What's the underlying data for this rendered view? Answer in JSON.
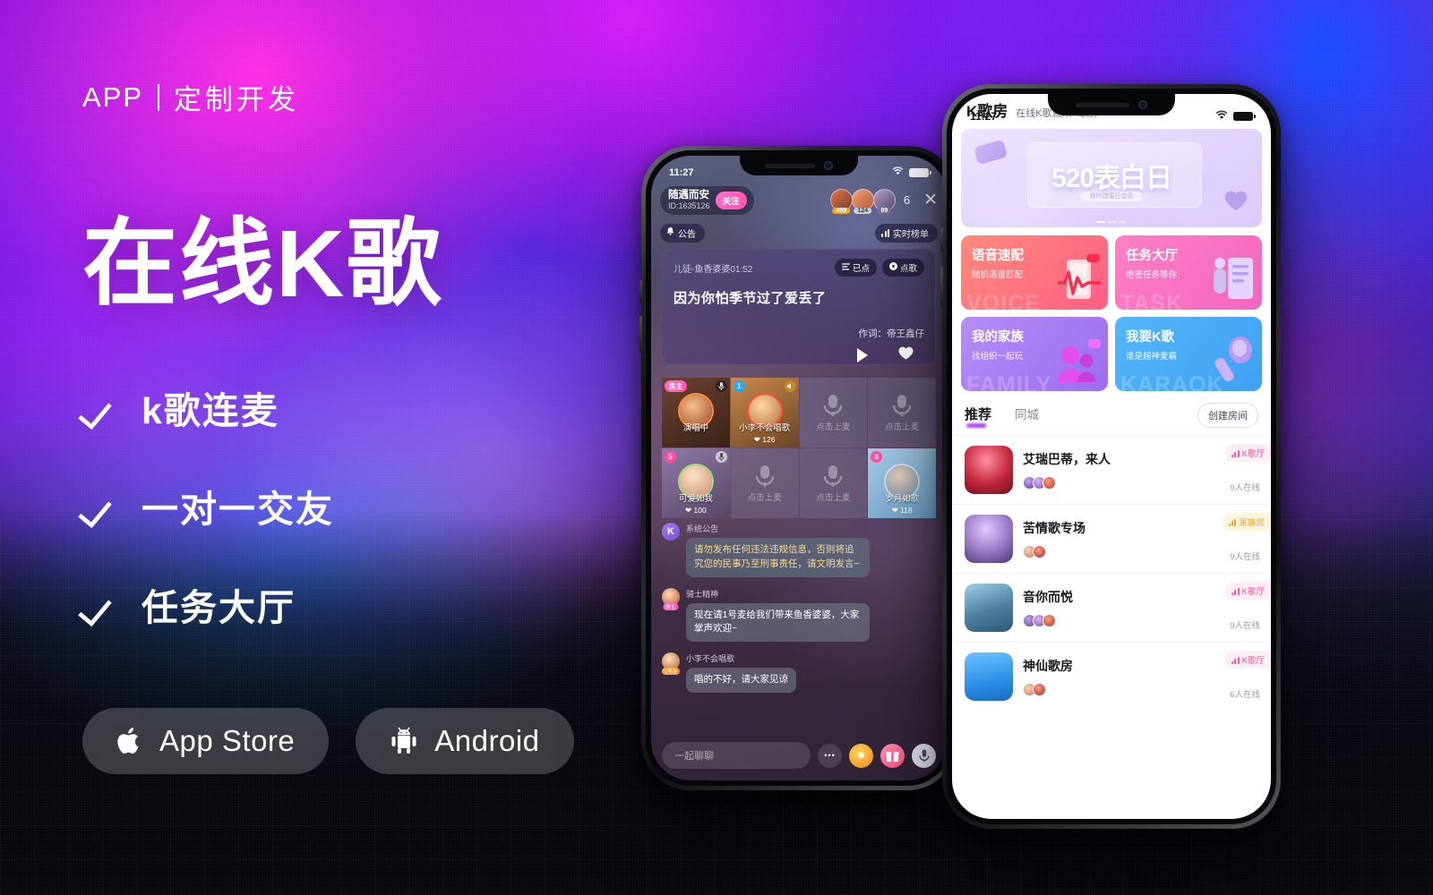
{
  "brand": {
    "eyebrow_left": "APP",
    "eyebrow_right": "定制开发",
    "headline": "在线K歌",
    "accent": "#c44dff"
  },
  "features": [
    {
      "label": "k歌连麦"
    },
    {
      "label": "一对一交友"
    },
    {
      "label": "任务大厅"
    }
  ],
  "stores": [
    {
      "icon": "apple-icon",
      "label": "App Store"
    },
    {
      "icon": "android-icon",
      "label": "Android"
    }
  ],
  "phone_room": {
    "status": {
      "time": "11:27",
      "wifi": "wifi-icon",
      "battery": "battery-icon"
    },
    "owner": {
      "name": "随遇而安",
      "id": "ID:1635126",
      "follow_label": "关注"
    },
    "viewers": [
      {
        "count": "459",
        "color": "#f5a623"
      },
      {
        "count": "124",
        "color": "#c9cdd8"
      },
      {
        "count": "89",
        "color": "#7f6f96"
      }
    ],
    "viewer_total": "6",
    "close_label": "✕",
    "notice_label": "公告",
    "rank_label": "实时榜单",
    "song": {
      "title": "儿徒-鱼香婆婆01:52",
      "chip_ordered": "已点",
      "chip_order": "点歌",
      "lyric": "因为你怕季节过了爱丢了",
      "writer": "作词：帝王鑫仔"
    },
    "seats": [
      {
        "type": "host",
        "tag": "房主",
        "name": "演唱中",
        "likes": "",
        "mic": true
      },
      {
        "type": "user",
        "num": "1",
        "name": "小李不会唱歌",
        "likes": "126",
        "mic": false
      },
      {
        "type": "empty",
        "label": "点击上麦"
      },
      {
        "type": "empty",
        "label": "点击上麦"
      },
      {
        "type": "user",
        "num": "5",
        "name": "可爱如我",
        "likes": "100",
        "mic": true
      },
      {
        "type": "empty",
        "label": "点击上麦"
      },
      {
        "type": "empty",
        "label": "点击上麦"
      },
      {
        "type": "user",
        "num": "8",
        "name": "岁月如歌",
        "likes": "118",
        "mic": false
      }
    ],
    "messages": [
      {
        "avatar_letter": "K",
        "name": "系统公告",
        "tag": "",
        "text": "请勿发布任何违法违规信息，否则将追究您的民事乃至刑事责任，请文明发言~",
        "style": "sys"
      },
      {
        "avatar_letter": "",
        "name": "骑士精神",
        "tag": "房主",
        "text": "现在请1号麦给我们带来鱼香婆婆，大家掌声欢迎~",
        "style": "norm"
      },
      {
        "avatar_letter": "",
        "name": "小李不会唱歌",
        "tag": "1号麦",
        "text": "唱的不好，请大家见谅",
        "style": "norm"
      }
    ],
    "input_placeholder": "一起聊聊",
    "bottom_buttons": [
      {
        "icon": "more-dots-icon",
        "glyph": "•••"
      },
      {
        "icon": "emoji-icon",
        "glyph": "✹"
      },
      {
        "icon": "gift-icon",
        "glyph": "🎁"
      },
      {
        "icon": "mic-icon",
        "glyph": "🎤"
      }
    ]
  },
  "phone_home": {
    "status": {
      "time": "11:27",
      "wifi": "wifi-icon",
      "battery": "battery-icon"
    },
    "header": {
      "title": "K歌房",
      "subtitle": "在线K歌就来K歌房"
    },
    "banner": {
      "main": "520",
      "main_small": "20",
      "title": "表白日",
      "sub": "限时甜蜜日会员"
    },
    "categories": [
      {
        "title": "语音速配",
        "sub": "随机语音匹配",
        "watermark": "VOICE",
        "color_from": "#ff8a7a",
        "color_to": "#ff5f86"
      },
      {
        "title": "任务大厅",
        "sub": "绝密任务等你",
        "watermark": "TASK",
        "color_from": "#ff7fc4",
        "color_to": "#f266c0"
      },
      {
        "title": "我的家族",
        "sub": "找组织一起玩",
        "watermark": "FAMILY",
        "color_from": "#b68cf5",
        "color_to": "#9a6ef0"
      },
      {
        "title": "我要K歌",
        "sub": "谁是超神麦霸",
        "watermark": "KARAOK",
        "color_from": "#54b7f7",
        "color_to": "#3fa0f5"
      }
    ],
    "tabs": [
      {
        "label": "推荐",
        "active": true
      },
      {
        "label": "同城",
        "active": false
      }
    ],
    "create_label": "创建房间",
    "rooms": [
      {
        "name": "艾瑞巴蒂，来人",
        "tag": "K歌厅",
        "tag_type": "k",
        "online": "9人在线",
        "thumb_from": "#c3263a",
        "thumb_to": "#7a1020",
        "members": 3
      },
      {
        "name": "苦情歌专场",
        "tag": "家族房",
        "tag_type": "f",
        "online": "9人在线",
        "thumb_from": "#9d7cc9",
        "thumb_to": "#6b4f9e",
        "members": 2
      },
      {
        "name": "音你而悦",
        "tag": "K歌厅",
        "tag_type": "k",
        "online": "9人在线",
        "thumb_from": "#6fa9c8",
        "thumb_to": "#3d6f92",
        "members": 3
      },
      {
        "name": "神仙歌房",
        "tag": "K歌厅",
        "tag_type": "k",
        "online": "6人在线",
        "thumb_from": "#3f9ef0",
        "thumb_to": "#1f76c9",
        "members": 2
      }
    ]
  }
}
